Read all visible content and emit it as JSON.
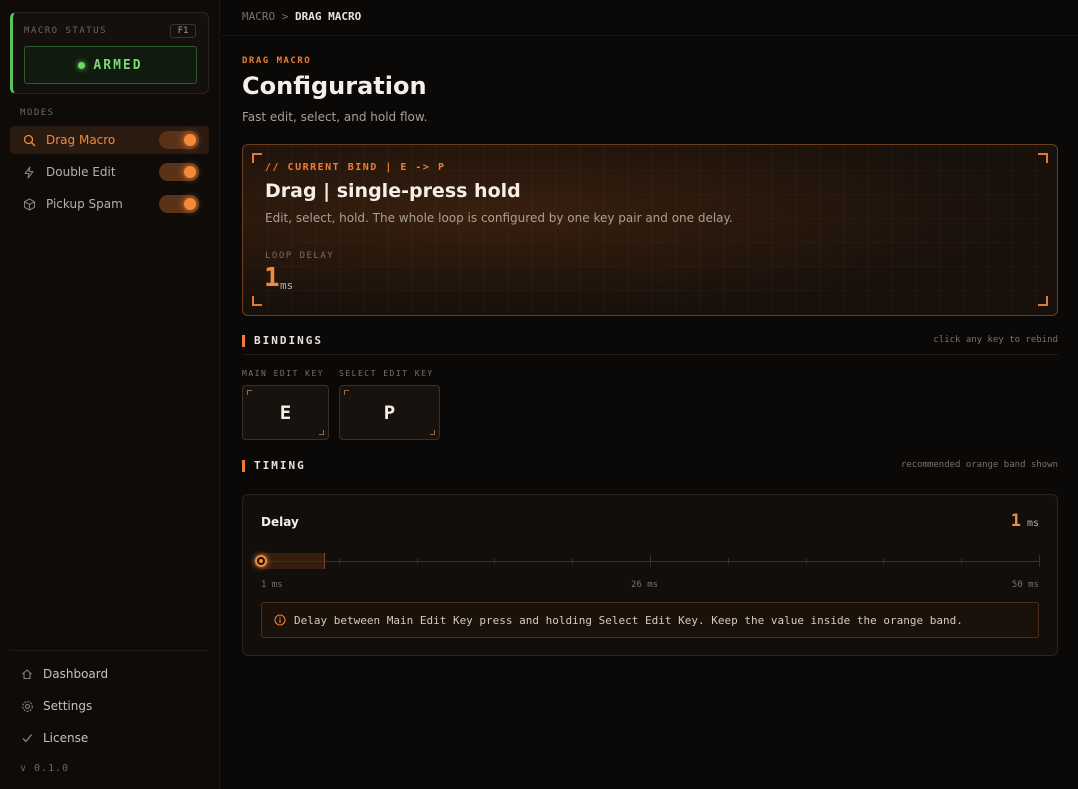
{
  "sidebar": {
    "status_label": "MACRO STATUS",
    "status_key": "F1",
    "status_text": "ARMED",
    "modes_label": "MODES",
    "modes": [
      {
        "label": "Drag Macro",
        "icon": "search-icon",
        "active": true,
        "enabled": true
      },
      {
        "label": "Double Edit",
        "icon": "bolt-icon",
        "active": false,
        "enabled": true
      },
      {
        "label": "Pickup Spam",
        "icon": "cube-icon",
        "active": false,
        "enabled": true
      }
    ],
    "bottom": [
      {
        "label": "Dashboard",
        "icon": "home-icon"
      },
      {
        "label": "Settings",
        "icon": "gear-icon"
      },
      {
        "label": "License",
        "icon": "check-icon"
      }
    ],
    "version": "v 0.1.0"
  },
  "breadcrumb": {
    "root": "MACRO",
    "sep": ">",
    "current": "DRAG MACRO"
  },
  "header": {
    "eyebrow": "DRAG MACRO",
    "title": "Configuration",
    "subtitle": "Fast edit, select, and hold flow."
  },
  "hero": {
    "eyebrow": "// CURRENT BIND | E -> P",
    "title": "Drag | single-press hold",
    "desc": "Edit, select, hold. The whole loop is configured by one key pair and one delay.",
    "loop_label": "LOOP DELAY",
    "loop_value": "1",
    "loop_unit": "ms"
  },
  "bindings": {
    "title": "BINDINGS",
    "note": "click any key to rebind",
    "keys": [
      {
        "label": "MAIN EDIT KEY",
        "key": "E"
      },
      {
        "label": "SELECT EDIT KEY",
        "key": "P"
      }
    ]
  },
  "timing": {
    "title": "TIMING",
    "note": "recommended orange band shown",
    "delay_label": "Delay",
    "delay_value": "1",
    "delay_unit": "ms",
    "slider_value": 1,
    "slider_min": 1,
    "slider_max": 50,
    "band": [
      1,
      5
    ],
    "min_label": "1 ms",
    "mid_label": "26 ms",
    "max_label": "50 ms",
    "info": "Delay between Main Edit Key press and holding Select Edit Key. Keep the value inside the orange band."
  },
  "colors": {
    "accent": "#ee7d33",
    "armed": "#7bd870",
    "background": "#0b0907"
  }
}
